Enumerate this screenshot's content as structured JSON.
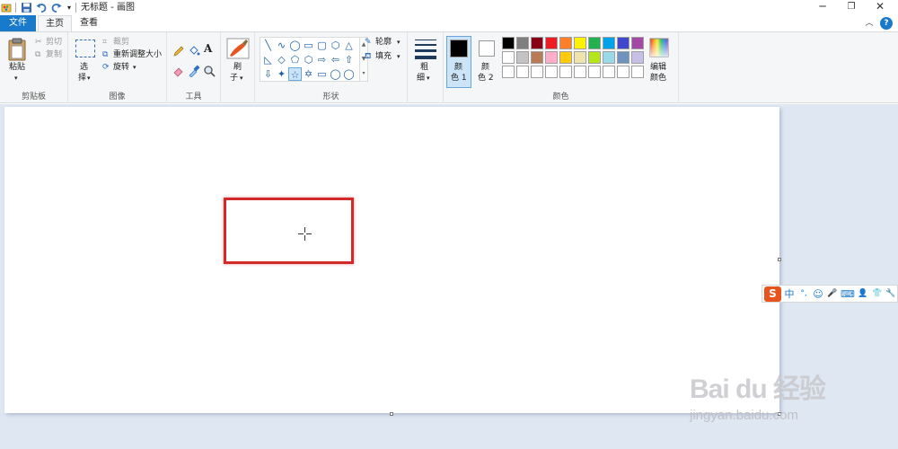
{
  "window": {
    "title": "无标题 - 画图",
    "minimize_glyph": "─",
    "maximize_glyph": "❐",
    "close_glyph": "✕",
    "qa_dropdown": "▾"
  },
  "tabs": [
    {
      "label": "文件"
    },
    {
      "label": "主页"
    },
    {
      "label": "查看"
    }
  ],
  "ribbon_help": "?",
  "ribbon_collapse": "︿",
  "groups": {
    "clipboard": {
      "label": "剪贴板",
      "paste": "粘贴",
      "cut": "剪切",
      "copy": "复制"
    },
    "image": {
      "label": "图像",
      "select_top": "选",
      "select_bottom": "择",
      "crop": "裁剪",
      "resize": "重新调整大小",
      "rotate": "旋转"
    },
    "tools": {
      "label": "工具"
    },
    "brush": {
      "top": "刷",
      "bottom": "子"
    },
    "shapes": {
      "label": "形状",
      "outline": "轮廓",
      "fill": "填充",
      "items": [
        "╲",
        "∿",
        "◯",
        "▭",
        "▢",
        "⬡",
        "△",
        "◺",
        "◇",
        "⬠",
        "⬡",
        "⇨",
        "⇦",
        "⇧",
        "⇩",
        "✦",
        "☆",
        "✡",
        "▭",
        "◯",
        "◯"
      ]
    },
    "size": {
      "top": "粗",
      "bottom": "细"
    },
    "colors": {
      "label": "颜色",
      "color1_top": "颜",
      "color1_bottom": "色 1",
      "color2_top": "颜",
      "color2_bottom": "色 2",
      "edit_top": "编辑",
      "edit_bottom": "颜色",
      "color1": "#000000",
      "color2": "#ffffff",
      "palette_row1": [
        "#000000",
        "#7f7f7f",
        "#880015",
        "#ed1c24",
        "#ff7f27",
        "#fff200",
        "#22b14c",
        "#00a2e8",
        "#3f48cc",
        "#a349a4"
      ],
      "palette_row2": [
        "#ffffff",
        "#c3c3c3",
        "#b97a57",
        "#ffaec9",
        "#ffc90e",
        "#efe4b0",
        "#b5e61d",
        "#99d9ea",
        "#7092be",
        "#c8bfe7"
      ],
      "palette_row3": [
        "#ffffff",
        "#ffffff",
        "#ffffff",
        "#ffffff",
        "#ffffff",
        "#ffffff",
        "#ffffff",
        "#ffffff",
        "#ffffff",
        "#ffffff"
      ]
    }
  },
  "ime": {
    "logo": "S",
    "mode": "中",
    "punct": "°,",
    "emoji": "☺",
    "voice": "🎤",
    "keyboard": "⌨",
    "user": "👤",
    "skin": "👕",
    "settings": "🔧"
  },
  "watermark": {
    "main": "Bai du 经验",
    "sub": "jingyan.baidu.com"
  }
}
